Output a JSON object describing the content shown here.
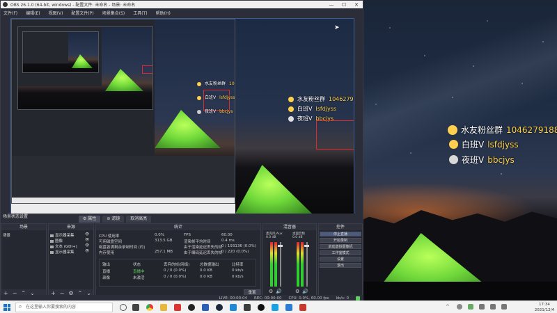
{
  "window": {
    "title": "OBS 26.1.0 (64-bit, windows) - 配置文件: 未命名 - 场景: 未命名",
    "controls": [
      "—",
      "☐",
      "✕"
    ]
  },
  "menu": [
    "文件(F)",
    "编辑(E)",
    "视图(V)",
    "配置文件(P)",
    "场景集合(S)",
    "工具(T)",
    "帮助(H)"
  ],
  "overlay": {
    "line1_label": "水友粉丝群",
    "line1_value": "1046279188",
    "line2_label": "白班V",
    "line2_value": "lsfdjyss",
    "line3_label": "夜班V",
    "line3_value": "bbcjys"
  },
  "preview": {
    "cursor_visible": true
  },
  "docks": {
    "scene_header": "场景状态设置",
    "tabs": [
      "属性",
      "滤镜",
      "取消高亮"
    ],
    "scenes": {
      "title": "场景",
      "items": [
        "场景"
      ]
    },
    "sources": {
      "title": "来源",
      "items": [
        "显示器采集",
        "图像",
        "文本 (GDI+)",
        "显示器采集"
      ]
    },
    "stats": {
      "title": "统计",
      "rows": [
        [
          "CPU 使用率",
          "0.0%",
          "FPS",
          "60.00"
        ],
        [
          "可用磁盘空间",
          "313.5 GB",
          "渲染帧平均时间",
          "0.4 ms"
        ],
        [
          "磁盘容满剩余录制时间 (约)",
          "",
          "由于渲染延迟丢失的帧",
          "0 / 193136 (0.0%)"
        ],
        [
          "内存使用",
          "257.1 MB",
          "由于编码延迟丢失的帧",
          "0 / 220 (0.0%)"
        ]
      ],
      "table_header": [
        "输出",
        "状态",
        "丢弃的帧(网络)",
        "总数据输出",
        "比特率"
      ],
      "table_rows": [
        [
          "直播",
          "直播中",
          "0 / 0 (0.0%)",
          "0.0 KB",
          "0 kb/s"
        ],
        [
          "录像",
          "未激活",
          "0 / 0 (0.0%)",
          "0.0 KB",
          "0 kb/s"
        ]
      ],
      "reset": "重置"
    },
    "mixer": {
      "title": "混音器",
      "channels": [
        {
          "name": "麦克风/Aux",
          "db": "0.0 dB"
        },
        {
          "name": "桌面音频",
          "db": "0.0 dB"
        }
      ]
    },
    "controls": {
      "title": "控件",
      "buttons": [
        "停止直播",
        "开始录制",
        "启动虚拟摄像机",
        "工作室模式",
        "设置",
        "退出"
      ]
    }
  },
  "statusbar": {
    "live": "LIVE: 00:00:04",
    "rec": "REC: 00:00:00",
    "cpu": "CPU: 0.0%, 60.00 fps",
    "kbps": "kb/s: 0"
  },
  "taskbar": {
    "search_placeholder": "在这里输入你要搜索的内容",
    "time": "17:34",
    "date": "2021/12/4"
  },
  "colors": {
    "obs_bg": "#2b2e38",
    "accent": "#3c5f98",
    "overlay_value": "#ffd24a",
    "live_green": "#5cd05c",
    "selection_red": "#e0282e"
  }
}
